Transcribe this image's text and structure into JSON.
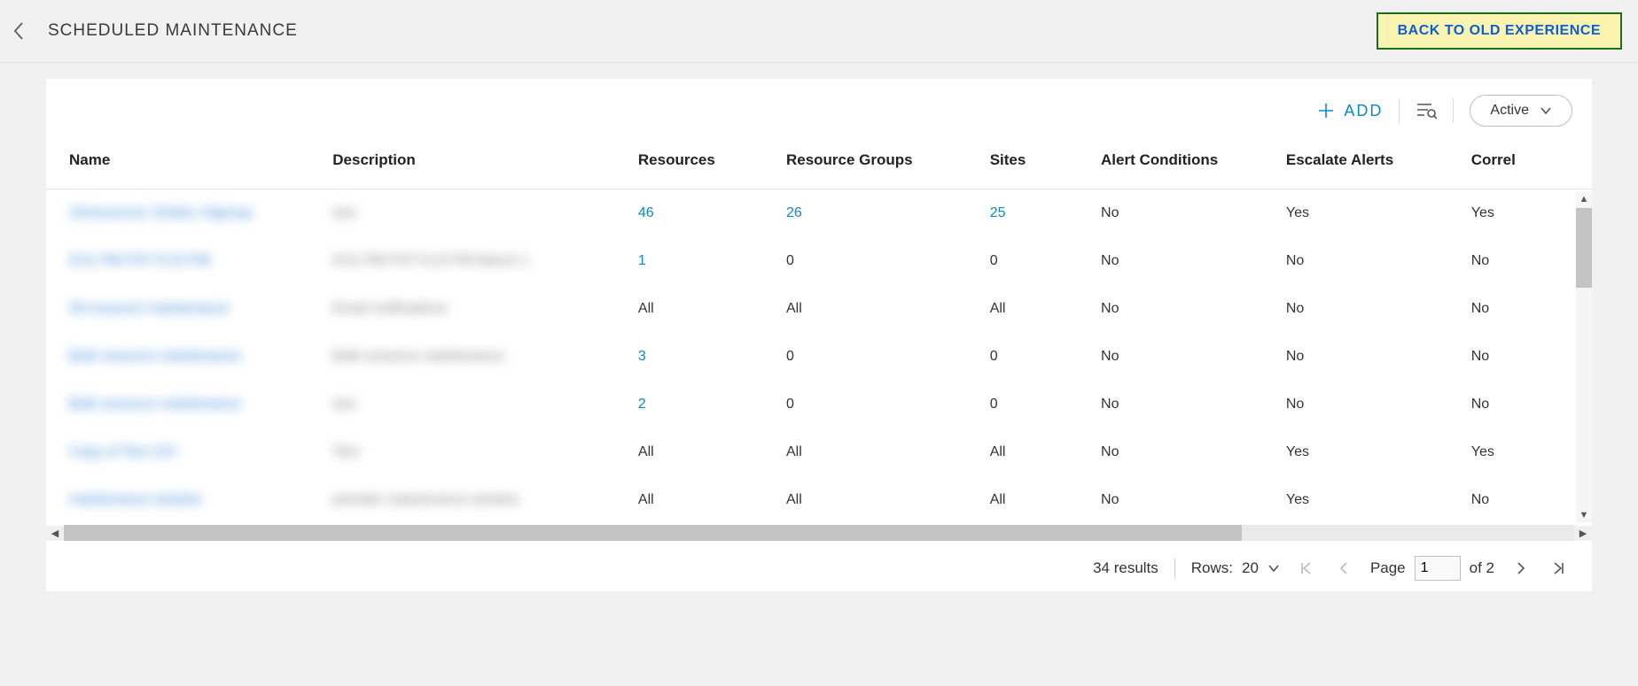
{
  "header": {
    "title": "SCHEDULED MAINTENANCE",
    "old_experience_label": "BACK TO OLD EXPERIENCE"
  },
  "toolbar": {
    "add_label": "ADD",
    "status_filter_label": "Active"
  },
  "table": {
    "columns": {
      "name": "Name",
      "description": "Description",
      "resources": "Resources",
      "resource_groups": "Resource Groups",
      "sites": "Sites",
      "alert_conditions": "Alert Conditions",
      "escalate_alerts": "Escalate Alerts",
      "correl": "Correl"
    },
    "rows": [
      {
        "name_blur": "10resources 15sites 10group",
        "desc_blur": "test",
        "resources": "46",
        "resources_link": true,
        "resource_groups": "26",
        "resource_groups_link": true,
        "sites": "25",
        "sites_link": true,
        "alert_conditions": "No",
        "escalate_alerts": "Yes",
        "correl": "Yes"
      },
      {
        "name_blur": "8:01 PM PST  8:15 PM",
        "desc_blur": "8:01 PM PST  8:15 PM March 1",
        "resources": "1",
        "resources_link": true,
        "resource_groups": "0",
        "resource_groups_link": false,
        "sites": "0",
        "sites_link": false,
        "alert_conditions": "No",
        "escalate_alerts": "No",
        "correl": "No"
      },
      {
        "name_blur": "All resource maintenance",
        "desc_blur": "Email notifications",
        "resources": "All",
        "resources_link": false,
        "resource_groups": "All",
        "resource_groups_link": false,
        "sites": "All",
        "sites_link": false,
        "alert_conditions": "No",
        "escalate_alerts": "No",
        "correl": "No"
      },
      {
        "name_blur": "Bulk resource maintenance",
        "desc_blur": "Bulk resource maintenance",
        "resources": "3",
        "resources_link": true,
        "resource_groups": "0",
        "resource_groups_link": false,
        "sites": "0",
        "sites_link": false,
        "alert_conditions": "No",
        "escalate_alerts": "No",
        "correl": "No"
      },
      {
        "name_blur": "Bulk resource maintenance",
        "desc_blur": "test",
        "resources": "2",
        "resources_link": true,
        "resource_groups": "0",
        "resource_groups_link": false,
        "sites": "0",
        "sites_link": false,
        "alert_conditions": "No",
        "escalate_alerts": "No",
        "correl": "No"
      },
      {
        "name_blur": "Copy of Test 123",
        "desc_blur": "Test",
        "resources": "All",
        "resources_link": false,
        "resource_groups": "All",
        "resource_groups_link": false,
        "sites": "All",
        "sites_link": false,
        "alert_conditions": "No",
        "escalate_alerts": "Yes",
        "correl": "Yes"
      },
      {
        "name_blur": "maintenance window",
        "desc_blur": "periodic maintenance window",
        "resources": "All",
        "resources_link": false,
        "resource_groups": "All",
        "resource_groups_link": false,
        "sites": "All",
        "sites_link": false,
        "alert_conditions": "No",
        "escalate_alerts": "Yes",
        "correl": "No"
      }
    ]
  },
  "pager": {
    "results_text": "34 results",
    "rows_label": "Rows:",
    "rows_value": "20",
    "page_label": "Page",
    "page_current": "1",
    "page_of": "of 2"
  }
}
